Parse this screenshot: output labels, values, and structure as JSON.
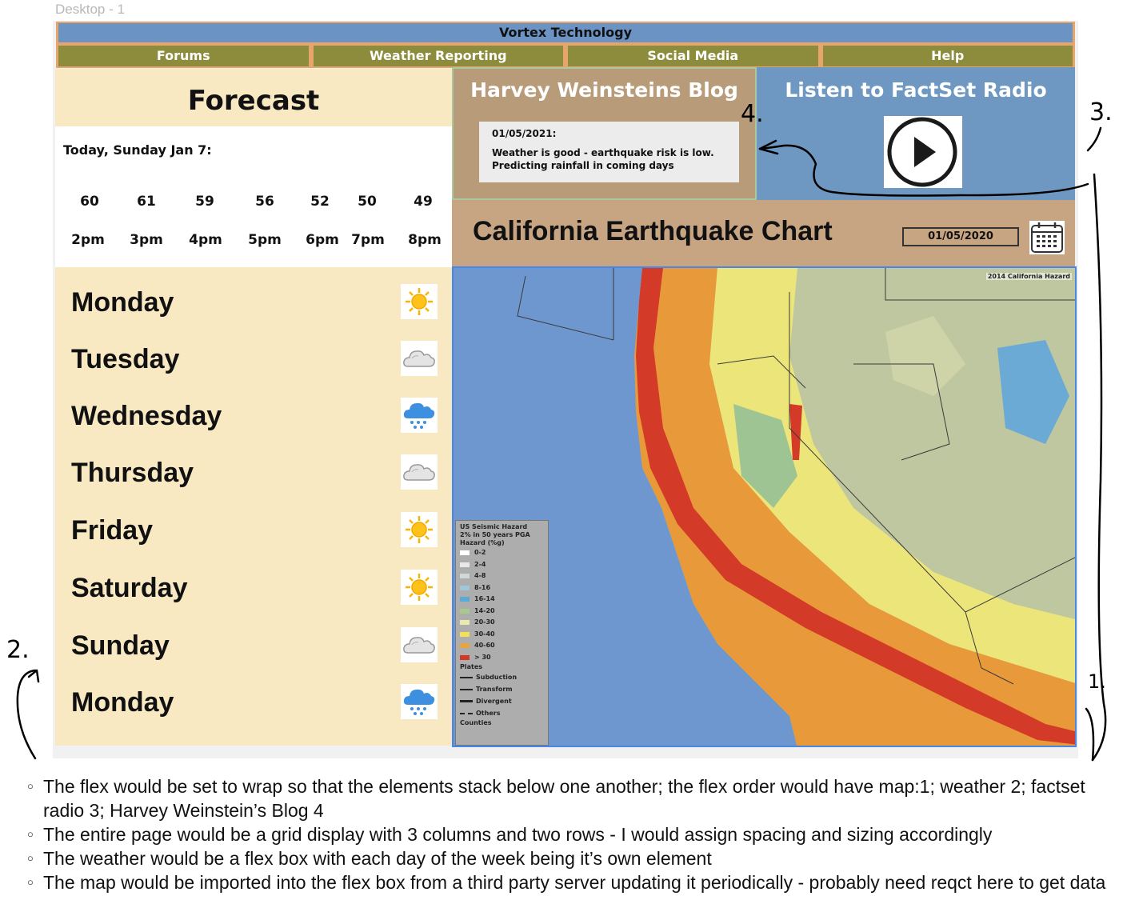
{
  "frame": {
    "label": "Desktop - 1"
  },
  "header": {
    "title": "Vortex Technology"
  },
  "nav": {
    "items": [
      {
        "label": "Forums"
      },
      {
        "label": "Weather Reporting"
      },
      {
        "label": "Social Media"
      },
      {
        "label": "Help"
      }
    ]
  },
  "forecast": {
    "title": "Forecast",
    "today": "Today, Sunday Jan 7:",
    "hourly": [
      {
        "temp": "60",
        "time": "2pm"
      },
      {
        "temp": "61",
        "time": "3pm"
      },
      {
        "temp": "59",
        "time": "4pm"
      },
      {
        "temp": "56",
        "time": "5pm"
      },
      {
        "temp": "52",
        "time": "6pm"
      },
      {
        "temp": "50",
        "time": "7pm"
      },
      {
        "temp": "49",
        "time": "8pm"
      }
    ],
    "days": [
      {
        "name": "Monday",
        "icon": "sun-icon"
      },
      {
        "name": "Tuesday",
        "icon": "cloud-icon"
      },
      {
        "name": "Wednesday",
        "icon": "rain-cloud-icon"
      },
      {
        "name": "Thursday",
        "icon": "cloud-icon"
      },
      {
        "name": "Friday",
        "icon": "sun-icon"
      },
      {
        "name": "Saturday",
        "icon": "sun-icon"
      },
      {
        "name": "Sunday",
        "icon": "cloud-icon"
      },
      {
        "name": "Monday",
        "icon": "rain-cloud-icon"
      }
    ]
  },
  "blog": {
    "title": "Harvey Weinsteins Blog",
    "date": "01/05/2021:",
    "text_line1": "Weather is good - earthquake risk is low.",
    "text_line2": "Predicting rainfall in coming days"
  },
  "radio": {
    "title": "Listen to FactSet Radio",
    "icon": "play-icon"
  },
  "earthquake": {
    "title": "California Earthquake Chart",
    "date_value": "01/05/2020",
    "calendar_icon": "calendar-icon",
    "map_title": "2014 California Hazard",
    "legend": {
      "title_line1": "US Seismic Hazard",
      "title_line2": "2% in 50 years PGA",
      "unit": "Hazard (%g)",
      "bins": [
        {
          "label": "0-2",
          "color": "#ffffff"
        },
        {
          "label": "2-4",
          "color": "#e8e8e8"
        },
        {
          "label": "4-8",
          "color": "#cfd8d6"
        },
        {
          "label": "8-16",
          "color": "#9fc6d9"
        },
        {
          "label": "16-14",
          "color": "#5aa9d6"
        },
        {
          "label": "14-20",
          "color": "#a9c98a"
        },
        {
          "label": "20-30",
          "color": "#eaeab0"
        },
        {
          "label": "30-40",
          "color": "#f0e05a"
        },
        {
          "label": "40-60",
          "color": "#e8a440"
        },
        {
          "label": "> 30",
          "color": "#d23a28"
        }
      ],
      "plates_label": "Plates",
      "plates": [
        "Subduction",
        "Transform",
        "Divergent",
        "Others"
      ],
      "counties_label": "Counties"
    }
  },
  "annotations": {
    "n1": "1.",
    "n2": "2.",
    "n3": "3.",
    "n4": "4."
  },
  "notes": [
    "The flex would be set to wrap so that the elements stack below one another; the flex order would have map:1; weather 2; factset radio 3; Harvey Weinstein’s Blog 4",
    "The entire page would be a grid display with 3 columns and two rows - I would assign spacing and sizing accordingly",
    "The weather would be a flex box with each day of the week being it’s own element",
    "The map would be imported into the flex box from a third party server updating it periodically - probably need reqct here to get data"
  ],
  "colors": {
    "header_blue": "#6b93c3",
    "nav_olive": "#8c8c3c",
    "forecast_cream": "#f8e9c2",
    "blog_tan": "#b89c7a",
    "radio_blue": "#6e98c2",
    "map_border": "#4a86e8"
  }
}
